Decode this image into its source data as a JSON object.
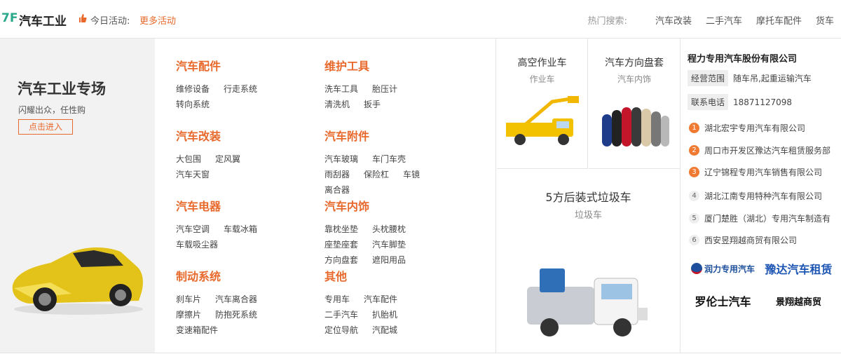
{
  "header": {
    "floor": "7F",
    "title": "汽车工业",
    "activity_label": "今日活动:",
    "activity_link": "更多活动",
    "hot_label": "热门搜索:",
    "hot_keywords": [
      "汽车改装",
      "二手汽车",
      "摩托车配件",
      "货车"
    ]
  },
  "promo": {
    "title": "汽车工业专场",
    "subtitle": "闪耀出众，任性购",
    "button": "点击进入"
  },
  "categories": [
    {
      "title": "汽车配件",
      "links": [
        "维修设备",
        "行走系统",
        "转向系统"
      ]
    },
    {
      "title": "维护工具",
      "links": [
        "洗车工具",
        "胎压计",
        "清洗机",
        "扳手"
      ]
    },
    {
      "title": "汽车改装",
      "links": [
        "大包围",
        "定风翼",
        "汽车天窗"
      ]
    },
    {
      "title": "汽车附件",
      "links": [
        "汽车玻璃",
        "车门车壳",
        "雨刮器",
        "保险杠",
        "车镜",
        "离合器"
      ]
    },
    {
      "title": "汽车电器",
      "links": [
        "汽车空调",
        "车载冰箱",
        "车载吸尘器"
      ]
    },
    {
      "title": "汽车内饰",
      "links": [
        "靠枕坐垫",
        "头枕腰枕",
        "座垫座套",
        "汽车脚垫",
        "方向盘套",
        "遮阳用品"
      ]
    },
    {
      "title": "制动系统",
      "links": [
        "刹车片",
        "汽车离合器",
        "摩擦片",
        "防抱死系统",
        "变速箱配件"
      ]
    },
    {
      "title": "其他",
      "links": [
        "专用车",
        "汽车配件",
        "二手汽车",
        "扒胎机",
        "定位导航",
        "汽配城"
      ]
    }
  ],
  "products": [
    {
      "name": "高空作业车",
      "category": "作业车"
    },
    {
      "name": "汽车方向盘套",
      "category": "汽车内饰"
    },
    {
      "name": "5方后装式垃圾车",
      "category": "垃圾车"
    }
  ],
  "company": {
    "name": "程力专用汽车股份有限公司",
    "scope_label": "经营范围",
    "scope_value": "随车吊,起重运输汽车",
    "phone_label": "联系电话",
    "phone_value": "18871127098",
    "ranking": [
      {
        "num": "1",
        "name": "湖北宏宇专用汽车有限公司"
      },
      {
        "num": "2",
        "name": "周口市开发区豫达汽车租赁服务部"
      },
      {
        "num": "3",
        "name": "辽宁锦程专用汽车销售有限公司"
      },
      {
        "num": "4",
        "name": "湖北江南专用特种汽车有限公司"
      },
      {
        "num": "5",
        "name": "厦门楚胜（湖北）专用汽车制造有"
      },
      {
        "num": "6",
        "name": "西安昱翔越商贸有限公司"
      }
    ],
    "logos": [
      "润力专用汽车",
      "豫达汽车租赁",
      "罗伦士汽车",
      "景翔越商贸"
    ]
  },
  "colors": {
    "accent": "#e8692c",
    "floor": "#29a88a",
    "rank_hot": "#f07a32"
  }
}
